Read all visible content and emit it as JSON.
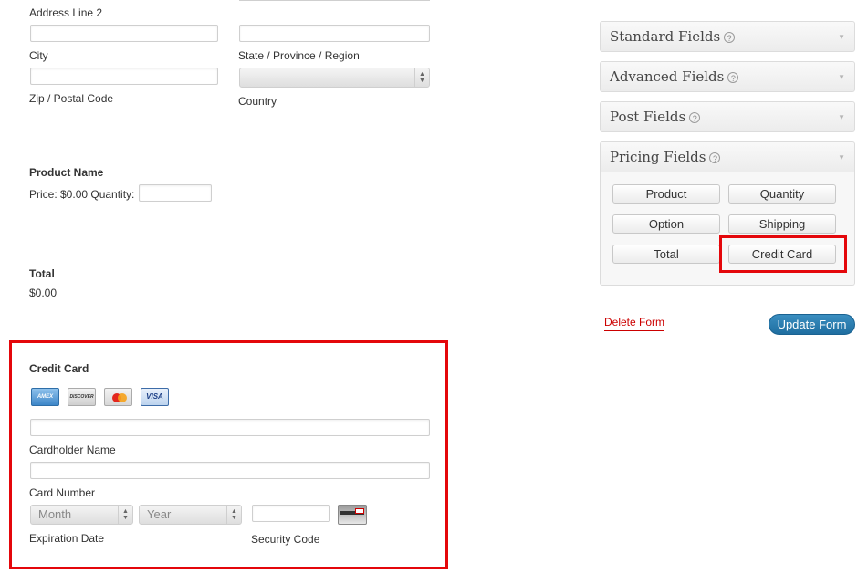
{
  "address": {
    "line2_label": "Address Line 2",
    "city_label": "City",
    "state_label": "State / Province / Region",
    "zip_label": "Zip / Postal Code",
    "country_label": "Country"
  },
  "product": {
    "name": "Product Name",
    "price_label": "Price: $0.00 Quantity:"
  },
  "total": {
    "label": "Total",
    "value": "$0.00"
  },
  "credit_card": {
    "title": "Credit Card",
    "cards": [
      "AMEX",
      "DISCOVER",
      "MasterCard",
      "VISA"
    ],
    "cardholder_label": "Cardholder Name",
    "card_number_label": "Card Number",
    "month_value": "Month",
    "year_value": "Year",
    "expiration_label": "Expiration Date",
    "security_label": "Security Code"
  },
  "sidebar": {
    "panels": [
      {
        "title": "Standard Fields"
      },
      {
        "title": "Advanced Fields"
      },
      {
        "title": "Post Fields"
      },
      {
        "title": "Pricing Fields"
      }
    ],
    "help_glyph": "?",
    "pricing_buttons": [
      "Product",
      "Quantity",
      "Option",
      "Shipping",
      "Total",
      "Credit Card"
    ],
    "delete_label": "Delete Form",
    "update_label": "Update Form"
  },
  "colors": {
    "highlight": "#e4070b",
    "update_button": "#2a7fb4",
    "delete_link": "#cc0000"
  }
}
